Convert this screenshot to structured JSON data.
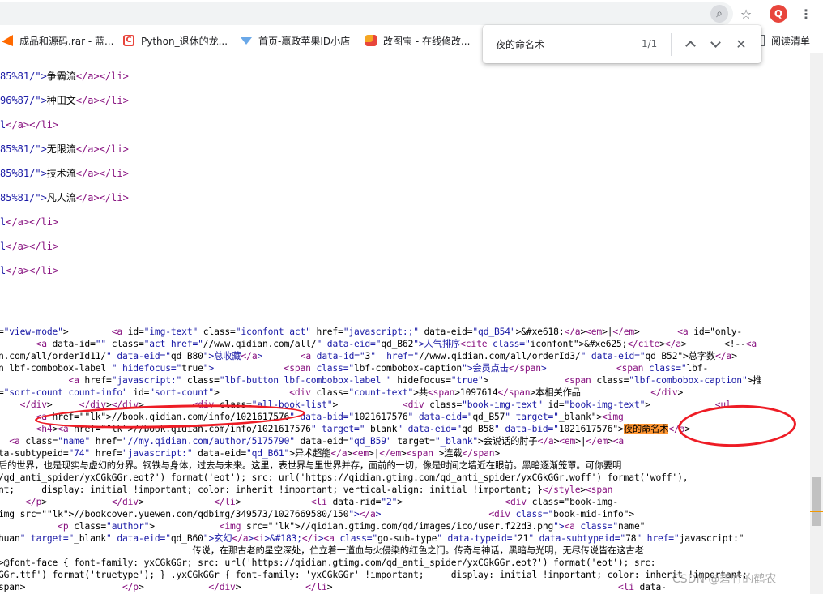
{
  "toolbar": {
    "lens_icon": "search-page-icon",
    "star_icon": "star-icon",
    "profile_initial": "Q",
    "menu_icon": "kebab-icon"
  },
  "bookmarks": [
    {
      "label": "成品和源码.rar - 蓝..."
    },
    {
      "label": "Python_退休的龙..."
    },
    {
      "label": "首页-赢政苹果ID小店"
    },
    {
      "label": "改图宝 - 在线修改..."
    },
    {
      "label": "阅读清单"
    }
  ],
  "find_bar": {
    "query": "夜的命名术",
    "count": "1/1"
  },
  "source": {
    "lines_top": [
      {
        "pre": "85%81/\">",
        "text": "争霸流",
        "post": "</a></li>"
      },
      {
        "pre": "96%87/\">",
        "text": "种田文",
        "post": "</a></li>"
      },
      {
        "pre": "l",
        "text": "",
        "post": "</a></li>"
      },
      {
        "pre": "85%81/\">",
        "text": "无限流",
        "post": "</a></li>"
      },
      {
        "pre": "85%81/\">",
        "text": "技术流",
        "post": "</a></li>"
      },
      {
        "pre": "85%81/\">",
        "text": "凡人流",
        "post": "</a></li>"
      },
      {
        "pre": "l",
        "text": "",
        "post": "</a></li>"
      },
      {
        "pre": "l",
        "text": "",
        "post": "</a></li>"
      },
      {
        "pre": "l",
        "text": "",
        "post": "</a></li>"
      }
    ],
    "lines_code": [
      "=\"view-mode\">        <a id=\"img-text\" class=\"iconfont act\" href=\"javascript:;\" data-eid=\"qd_B54\">&#xe618;</a><em>|</em>       <a id=\"only-",
      "       <a data-id=\"\" class=\"act href=\"//www.qidian.com/all/\" data-eid=\"qd_B62\">人气排序<cite class=\"iconfont\">&#xe625;</cite></a>       <!--<a",
      "n.com/all/orderId11/\" data-eid=\"qd_B80\">总收藏</a>       <a data-id=\"3\"  href=\"//www.qidian.com/all/orderId3/\" data-eid=\"qd_B52\">总字数</a>",
      "n lbf-combobox-label \" hidefocus=\"true\">             <span class=\"lbf-combobox-caption\">会员点击</span>             <span class=\"lbf-",
      "             <a href=\"javascript:\" class=\"lbf-button lbf-combobox-label \" hidefocus=\"true\">              <span class=\"lbf-combobox-caption\">推",
      "=\"sort-count count-info\" id=\"sort-count\">             <div class=\"count-text\">共<span>1097614</span>本相关作品             </div>",
      "    </div>     </div></div>         <div class=\"all-book-list\">            <div class=\"book-img-text\" id=\"book-img-text\">            <ul",
      "       <a href=\"//book.qidian.com/info/1021617576\" data-bid=\"1021617576\" data-eid=\"qd_B57\" target=\"_blank\"><img",
      "       <h4><a href=\"//book.qidian.com/info/1021617576\" target=\"_blank\" data-eid=\"qd_B58\" data-bid=\"1021617576\">夜的命名术</a>",
      "  <a class=\"name\" href=\"//my.qidian.com/author/5175790\" data-eid=\"qd_B59\" target=\"_blank\">会说话的肘子</a><em>|</em><a",
      "ta-subtypeid=\"74\" href=\"javascript:\" data-eid=\"qd_B61\">异术超能</a><em>|</em><span >连载</span>",
      "后的世界，也是现实与虚幻的分界。钢铁与身体，过去与未来。这里，表世界与里世界并存，面前的一切，像是时间之墙近在眼前。黑暗逐渐笼罩。可你要明",
      "/qd_anti_spider/yxCGkGGr.eot?') format('eot'); src: url('https://qidian.gtimg.com/qd_anti_spider/yxCGkGGr.woff') format('woff'),",
      "nt;     display: initial !important; color: inherit !important; vertical-align: initial !important; }</style><span",
      "     </p>            </div>             </li>             <li data-rid=\"2\">                   <div class=\"book-img-",
      "img src=\"//bookcover.yuewen.com/qdbimg/349573/1027669580/150\"></a>                    <div class=\"book-mid-info\">",
      "           <p class=\"author\">            <img src=\"//qidian.gtimg.com/qd/images/ico/user.f22d3.png\"><a class=\"name\"",
      "huan\" target=\"_blank\" data-eid=\"qd_B60\">玄幻</a><i>&#183;</i><a class=\"go-sub-type\" data-typeid=\"21\" data-subtypeid=\"78\" href=\"javascript:\"",
      "                                    传说，在那古老的星空深处，伫立着一道血与火侵染的红色之门。传奇与神话，黑暗与光明，无尽传说皆在这古老",
      ">@font-face { font-family: yxCGkGGr; src: url('https://qidian.gtimg.com/qd_anti_spider/yxCGkGGr.eot?') format('eot'); src:",
      "GGr.ttf') format('truetype'); } .yxCGkGGr { font-family: 'yxCGkGGr' !important;     display: initial !important; color: inherit !important;",
      "span>                  </p>            </div>            </li>                                                     <li data-"
    ]
  },
  "watermark": "CSDN @碧竹的鹤农"
}
